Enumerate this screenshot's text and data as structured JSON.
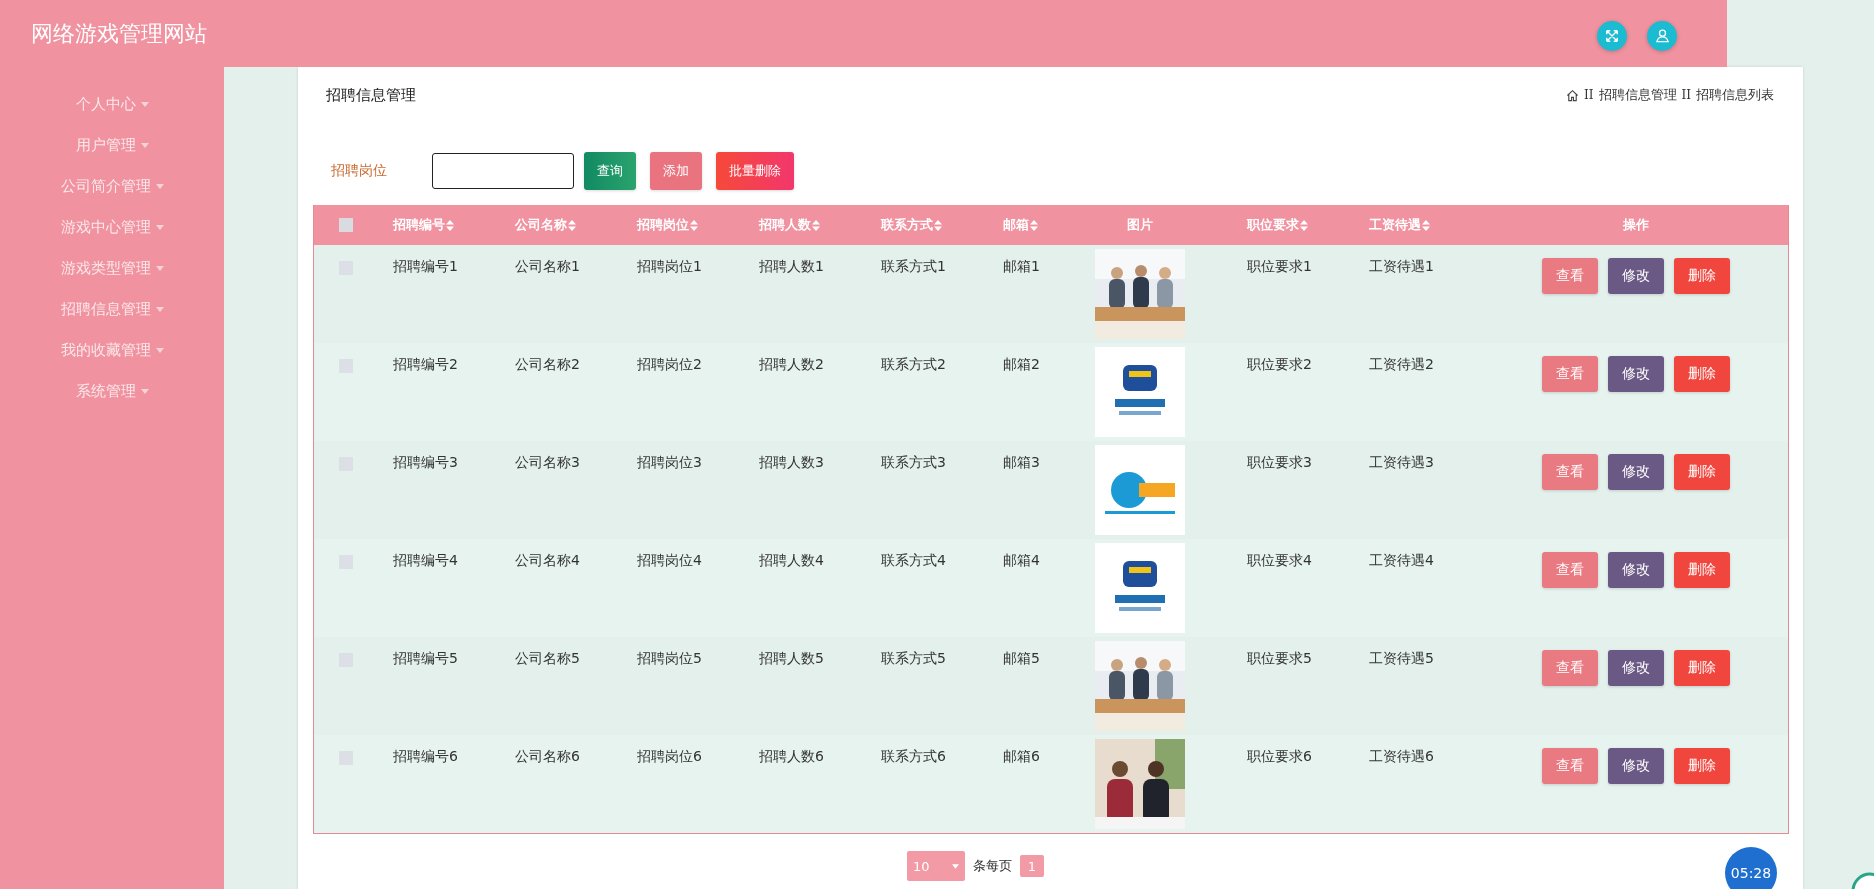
{
  "header": {
    "title": "网络游戏管理网站"
  },
  "sidebar": {
    "items": [
      {
        "label": "个人中心"
      },
      {
        "label": "用户管理"
      },
      {
        "label": "公司简介管理"
      },
      {
        "label": "游戏中心管理"
      },
      {
        "label": "游戏类型管理"
      },
      {
        "label": "招聘信息管理"
      },
      {
        "label": "我的收藏管理"
      },
      {
        "label": "系统管理"
      }
    ]
  },
  "page": {
    "title": "招聘信息管理",
    "breadcrumb": [
      {
        "separator": "II",
        "label": "招聘信息管理"
      },
      {
        "separator": "II",
        "label": "招聘信息列表"
      }
    ]
  },
  "search": {
    "label": "招聘岗位",
    "buttons": [
      {
        "kind": "search",
        "label": "查询"
      },
      {
        "kind": "add",
        "label": "添加"
      },
      {
        "kind": "delete",
        "label": "批量删除"
      }
    ]
  },
  "table": {
    "all_selected": false,
    "columns": [
      {
        "label": "招聘编号",
        "kind": "text",
        "sortable": true
      },
      {
        "label": "公司名称",
        "kind": "text",
        "sortable": true
      },
      {
        "label": "招聘岗位",
        "kind": "text",
        "sortable": true
      },
      {
        "label": "招聘人数",
        "kind": "text",
        "sortable": true
      },
      {
        "label": "联系方式",
        "kind": "text",
        "sortable": true
      },
      {
        "label": "邮箱",
        "kind": "text",
        "sortable": true
      },
      {
        "label": "图片",
        "kind": "picture",
        "sortable": false
      },
      {
        "label": "职位要求",
        "kind": "text",
        "sortable": true
      },
      {
        "label": "工资待遇",
        "kind": "text",
        "sortable": true
      },
      {
        "label": "操作",
        "kind": "actions",
        "sortable": false
      }
    ],
    "rows": [
      {
        "selected": false,
        "cells": [
          "招聘编号1",
          "公司名称1",
          "招聘岗位1",
          "招聘人数1",
          "联系方式1",
          "邮箱1",
          {
            "kind": "picture"
          },
          "职位要求1",
          "工资待遇1",
          [
            "查看",
            "修改",
            "删除"
          ]
        ]
      },
      {
        "selected": false,
        "cells": [
          "招聘编号2",
          "公司名称2",
          "招聘岗位2",
          "招聘人数2",
          "联系方式2",
          "邮箱2",
          {
            "kind": "picture"
          },
          "职位要求2",
          "工资待遇2",
          [
            "查看",
            "修改",
            "删除"
          ]
        ]
      },
      {
        "selected": false,
        "cells": [
          "招聘编号3",
          "公司名称3",
          "招聘岗位3",
          "招聘人数3",
          "联系方式3",
          "邮箱3",
          {
            "kind": "picture"
          },
          "职位要求3",
          "工资待遇3",
          [
            "查看",
            "修改",
            "删除"
          ]
        ]
      },
      {
        "selected": false,
        "cells": [
          "招聘编号4",
          "公司名称4",
          "招聘岗位4",
          "招聘人数4",
          "联系方式4",
          "邮箱4",
          {
            "kind": "picture"
          },
          "职位要求4",
          "工资待遇4",
          [
            "查看",
            "修改",
            "删除"
          ]
        ]
      },
      {
        "selected": false,
        "cells": [
          "招聘编号5",
          "公司名称5",
          "招聘岗位5",
          "招聘人数5",
          "联系方式5",
          "邮箱5",
          {
            "kind": "picture"
          },
          "职位要求5",
          "工资待遇5",
          [
            "查看",
            "修改",
            "删除"
          ]
        ]
      },
      {
        "selected": false,
        "cells": [
          "招聘编号6",
          "公司名称6",
          "招聘岗位6",
          "招聘人数6",
          "联系方式6",
          "邮箱6",
          {
            "kind": "picture"
          },
          "职位要求6",
          "工资待遇6",
          [
            "查看",
            "修改",
            "删除"
          ]
        ]
      }
    ]
  },
  "pagination": {
    "page_size": "10",
    "per_page_label": "条每页",
    "pages": [
      {
        "label": "1",
        "selected": true
      }
    ]
  },
  "timer": "05:28"
}
